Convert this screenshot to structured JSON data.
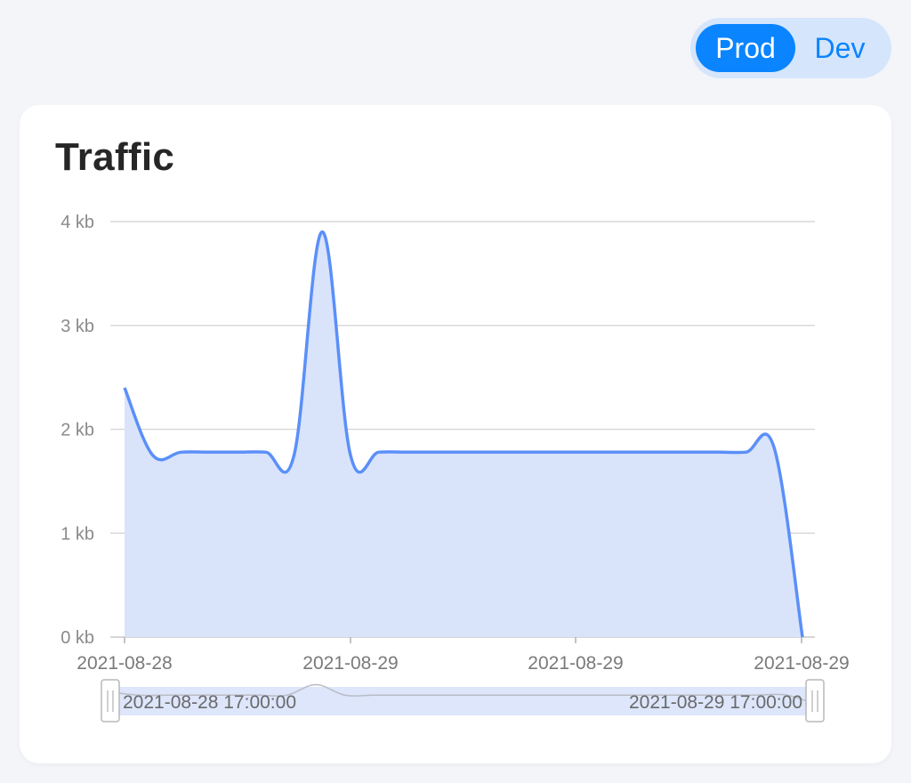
{
  "env_toggle": {
    "options": [
      "Prod",
      "Dev"
    ],
    "selected": "Prod"
  },
  "card": {
    "title": "Traffic"
  },
  "colors": {
    "accent": "#0a84ff",
    "line": "#5b8ff9",
    "area": "#d9e4fb",
    "grid": "#d9d9d9"
  },
  "chart_data": {
    "type": "area",
    "title": "Traffic",
    "xlabel": "",
    "ylabel": "",
    "smooth": true,
    "grid": true,
    "y_ticks": [
      "0 kb",
      "1 kb",
      "2 kb",
      "3 kb",
      "4 kb"
    ],
    "ylim": [
      0,
      4
    ],
    "x_ticks": [
      "2021-08-28",
      "2021-08-29",
      "2021-08-29",
      "2021-08-29"
    ],
    "x": [
      0,
      1,
      2,
      3,
      4,
      5,
      6,
      7,
      8,
      9,
      10,
      11,
      12,
      13,
      14,
      15,
      16,
      17,
      18,
      19,
      20,
      21,
      22,
      23,
      24
    ],
    "series": [
      {
        "values": [
          2.4,
          1.75,
          1.78,
          1.78,
          1.78,
          1.78,
          1.75,
          3.9,
          1.75,
          1.78,
          1.78,
          1.78,
          1.78,
          1.78,
          1.78,
          1.78,
          1.78,
          1.78,
          1.78,
          1.78,
          1.78,
          1.78,
          1.78,
          1.82,
          0
        ]
      }
    ],
    "data_zoom": {
      "start_label": "2021-08-28 17:00:00",
      "end_label": "2021-08-29 17:00:00"
    }
  }
}
